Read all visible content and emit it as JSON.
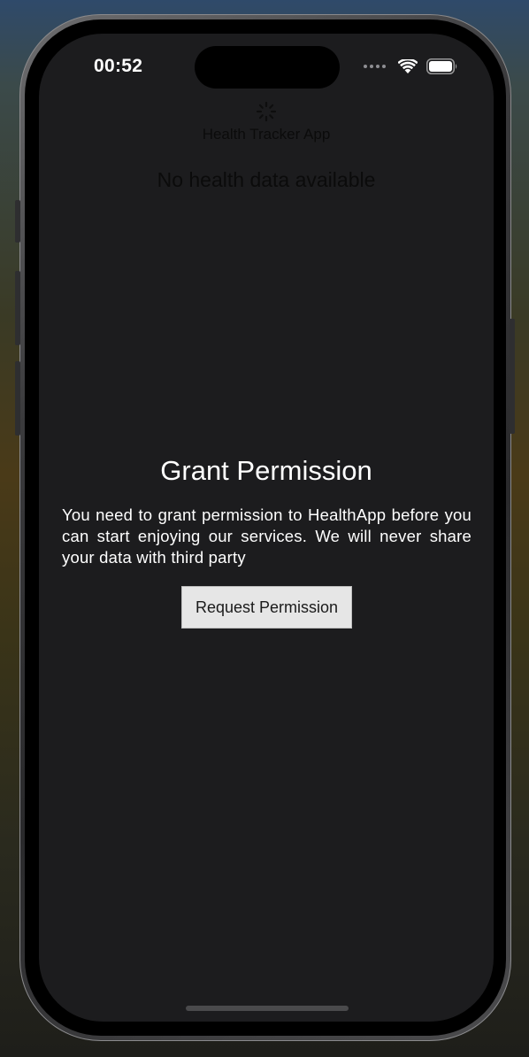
{
  "status_bar": {
    "time": "00:52",
    "icons": [
      "cellular-signal-icon",
      "wifi-icon",
      "battery-icon"
    ]
  },
  "background_screen": {
    "title": "Health Tracker App",
    "empty_message": "No health data available",
    "loading_indicator": "activity-spinner-icon"
  },
  "permission_dialog": {
    "title": "Grant Permission",
    "description": "You need to grant permission to HealthApp before you can start enjoying our services. We will never share your data with third party",
    "button_label": "Request Permission"
  },
  "colors": {
    "screen_background": "#1c1c1e",
    "button_background": "#e6e6e6",
    "text_primary": "#ffffff"
  }
}
